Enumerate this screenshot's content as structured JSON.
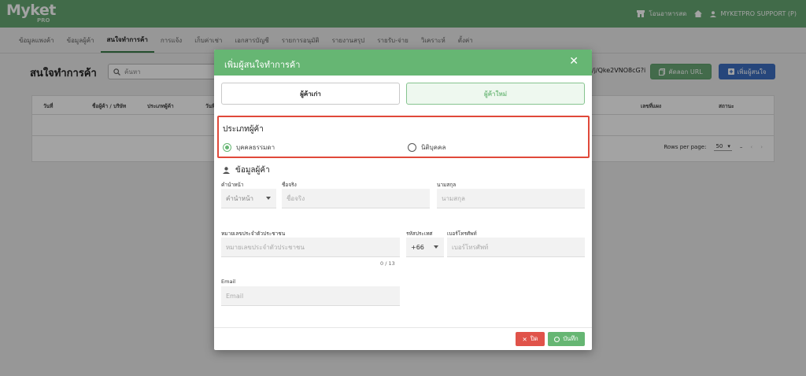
{
  "app": {
    "logo_text": "Myket",
    "logo_sub": "PRO",
    "store_label": "โอนอาหารสด",
    "user_label": "MYKETPRO SUPPORT (P)"
  },
  "nav": {
    "tabs": [
      {
        "label": "ข้อมูลแพงค้า",
        "active": false
      },
      {
        "label": "ข้อมูลผู้ค้า",
        "active": false
      },
      {
        "label": "สนใจทำการค้า",
        "active": true
      },
      {
        "label": "การแจ้ง",
        "active": false
      },
      {
        "label": "เก็บค่าเช่า",
        "active": false
      },
      {
        "label": "เอกสารบัญชี",
        "active": false
      },
      {
        "label": "รายการอนุมัติ",
        "active": false
      },
      {
        "label": "รายงานสรุป",
        "active": false
      },
      {
        "label": "รายรับ-จ่าย",
        "active": false
      },
      {
        "label": "วิเคราะห์",
        "active": false
      },
      {
        "label": "ตั้งค่า",
        "active": false
      }
    ]
  },
  "page": {
    "title": "สนใจทำการค้า",
    "search_placeholder": "ค้นหา",
    "url_fragment": "/j/Qke2VNO8cG?i",
    "copy_url_label": "คัดลอก URL",
    "add_interest_label": "เพิ่มผู้สนใจ"
  },
  "table": {
    "headers": [
      "วันที่",
      "ชื่อผู้ค้า / บริษัท",
      "ประเภทผู้ค้า",
      "วันที่",
      "เลขที่แผง",
      "สถานะ"
    ],
    "rows_per_page_label": "Rows per page:",
    "rows_per_page_value": "50",
    "range_text": "–"
  },
  "modal": {
    "title": "เพิ่มผู้สนใจทำการค้า",
    "close_icon": "✕",
    "segment_old": "ผู้ค้าเก่า",
    "segment_new": "ผู้ค้าใหม่",
    "type_title": "ประเภทผู้ค้า",
    "type_options": [
      {
        "label": "บุคคลธรรมดา",
        "checked": true
      },
      {
        "label": "นิติบุคคล",
        "checked": false
      }
    ],
    "section_title": "ข้อมูลผู้ค้า",
    "fields": {
      "prefix_label": "คำนำหน้า",
      "prefix_placeholder": "คำนำหน้า",
      "firstname_label": "ชื่อจริง",
      "firstname_placeholder": "ชื่อจริง",
      "lastname_label": "นามสกุล",
      "lastname_placeholder": "นามสกุล",
      "idcard_label": "หมายเลขประจำตัวประชาชน",
      "idcard_placeholder": "หมายเลขประจำตัวประชาชน",
      "idcard_counter": "0 / 13",
      "country_code_label": "รหัสประเทศ",
      "country_code_value": "+66",
      "phone_label": "เบอร์โทรศัพท์",
      "phone_placeholder": "เบอร์โทรศัพท์",
      "email_label": "Email",
      "email_placeholder": "Email"
    },
    "close_button_label": "ปิด",
    "save_button_label": "บันทึก"
  },
  "colors": {
    "brand_green": "#66b673",
    "highlight_red": "#e0493a",
    "danger_red": "#e0534a",
    "primary_blue": "#3c6ec0"
  }
}
